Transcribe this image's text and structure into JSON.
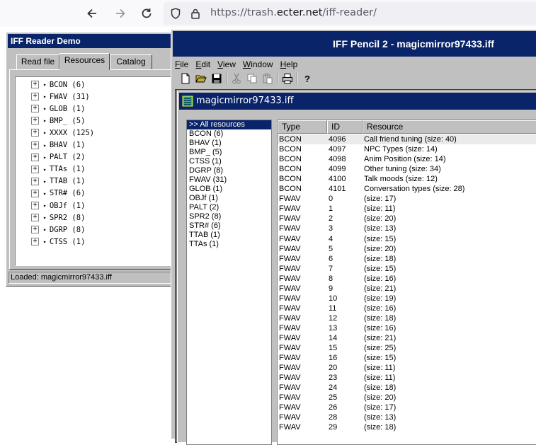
{
  "browser": {
    "url_prefix": "https://trash.",
    "url_domain": "ecter.net",
    "url_path": "/iff-reader/",
    "icons": [
      "back-arrow-icon",
      "forward-arrow-icon",
      "reload-icon",
      "shield-icon",
      "lock-icon"
    ]
  },
  "left_window": {
    "title": "IFF Reader Demo",
    "tabs": [
      {
        "label": "Read file"
      },
      {
        "label": "Resources"
      },
      {
        "label": "Catalog"
      }
    ],
    "active_tab": "Resources",
    "tree": [
      {
        "expander": "+",
        "label": "BCON (6)"
      },
      {
        "expander": "+",
        "label": "FWAV (31)"
      },
      {
        "expander": "+",
        "label": "GLOB (1)"
      },
      {
        "expander": "+",
        "label": "BMP_ (5)"
      },
      {
        "expander": "+",
        "label": "XXXX (125)"
      },
      {
        "expander": "+",
        "label": "BHAV (1)"
      },
      {
        "expander": "+",
        "label": "PALT (2)"
      },
      {
        "expander": "+",
        "label": "TTAs (1)"
      },
      {
        "expander": "+",
        "label": "TTAB (1)"
      },
      {
        "expander": "+",
        "label": "STR# (6)"
      },
      {
        "expander": "+",
        "label": "OBJf (1)"
      },
      {
        "expander": "+",
        "label": "SPR2 (8)"
      },
      {
        "expander": "+",
        "label": "DGRP (8)"
      },
      {
        "expander": "+",
        "label": "CTSS (1)"
      }
    ],
    "status": "Loaded: magicmirror97433.iff"
  },
  "right_window": {
    "title": "IFF Pencil 2 - magicmirror97433.iff",
    "menu": [
      {
        "key": "F",
        "rest": "ile"
      },
      {
        "key": "E",
        "rest": "dit"
      },
      {
        "key": "V",
        "rest": "iew"
      },
      {
        "key": "W",
        "rest": "indow"
      },
      {
        "key": "H",
        "rest": "elp"
      }
    ],
    "toolbar_icons": [
      "new-file-icon",
      "open-folder-icon",
      "save-disk-icon",
      "cut-icon",
      "copy-icon",
      "paste-icon",
      "print-icon",
      "help-icon"
    ],
    "child": {
      "title": "magicmirror97433.iff",
      "types": [
        ">> All resources",
        "BCON (6)",
        "BHAV (1)",
        "BMP_ (5)",
        "CTSS (1)",
        "DGRP (8)",
        "FWAV (31)",
        "GLOB (1)",
        "OBJf (1)",
        "PALT (2)",
        "SPR2 (8)",
        "STR# (6)",
        "TTAB (1)",
        "TTAs (1)"
      ],
      "selected_type": ">> All resources",
      "columns": [
        "Type",
        "ID",
        "Resource"
      ],
      "rows": [
        {
          "type": "BCON",
          "id": "4096",
          "res": "Call friend tuning (size: 40)"
        },
        {
          "type": "BCON",
          "id": "4097",
          "res": "NPC Types (size: 14)"
        },
        {
          "type": "BCON",
          "id": "4098",
          "res": "Anim Position (size: 14)"
        },
        {
          "type": "BCON",
          "id": "4099",
          "res": "Other tuning (size: 34)"
        },
        {
          "type": "BCON",
          "id": "4100",
          "res": "Talk moods (size: 12)"
        },
        {
          "type": "BCON",
          "id": "4101",
          "res": "Conversation types (size: 28)"
        },
        {
          "type": "FWAV",
          "id": "0",
          "res": " (size: 17)"
        },
        {
          "type": "FWAV",
          "id": "1",
          "res": " (size: 11)"
        },
        {
          "type": "FWAV",
          "id": "2",
          "res": " (size: 20)"
        },
        {
          "type": "FWAV",
          "id": "3",
          "res": " (size: 13)"
        },
        {
          "type": "FWAV",
          "id": "4",
          "res": " (size: 15)"
        },
        {
          "type": "FWAV",
          "id": "5",
          "res": " (size: 20)"
        },
        {
          "type": "FWAV",
          "id": "6",
          "res": " (size: 18)"
        },
        {
          "type": "FWAV",
          "id": "7",
          "res": " (size: 15)"
        },
        {
          "type": "FWAV",
          "id": "8",
          "res": " (size: 16)"
        },
        {
          "type": "FWAV",
          "id": "9",
          "res": " (size: 21)"
        },
        {
          "type": "FWAV",
          "id": "10",
          "res": " (size: 19)"
        },
        {
          "type": "FWAV",
          "id": "11",
          "res": " (size: 16)"
        },
        {
          "type": "FWAV",
          "id": "12",
          "res": " (size: 18)"
        },
        {
          "type": "FWAV",
          "id": "13",
          "res": " (size: 16)"
        },
        {
          "type": "FWAV",
          "id": "14",
          "res": " (size: 21)"
        },
        {
          "type": "FWAV",
          "id": "15",
          "res": " (size: 25)"
        },
        {
          "type": "FWAV",
          "id": "16",
          "res": " (size: 15)"
        },
        {
          "type": "FWAV",
          "id": "20",
          "res": " (size: 11)"
        },
        {
          "type": "FWAV",
          "id": "23",
          "res": " (size: 11)"
        },
        {
          "type": "FWAV",
          "id": "24",
          "res": " (size: 18)"
        },
        {
          "type": "FWAV",
          "id": "25",
          "res": " (size: 20)"
        },
        {
          "type": "FWAV",
          "id": "26",
          "res": " (size: 17)"
        },
        {
          "type": "FWAV",
          "id": "28",
          "res": " (size: 13)"
        },
        {
          "type": "FWAV",
          "id": "29",
          "res": " (size: 18)"
        }
      ]
    }
  },
  "colors": {
    "title_bar": "#0a246a",
    "window_face": "#c0c0c0",
    "mdi_background": "#808080"
  }
}
